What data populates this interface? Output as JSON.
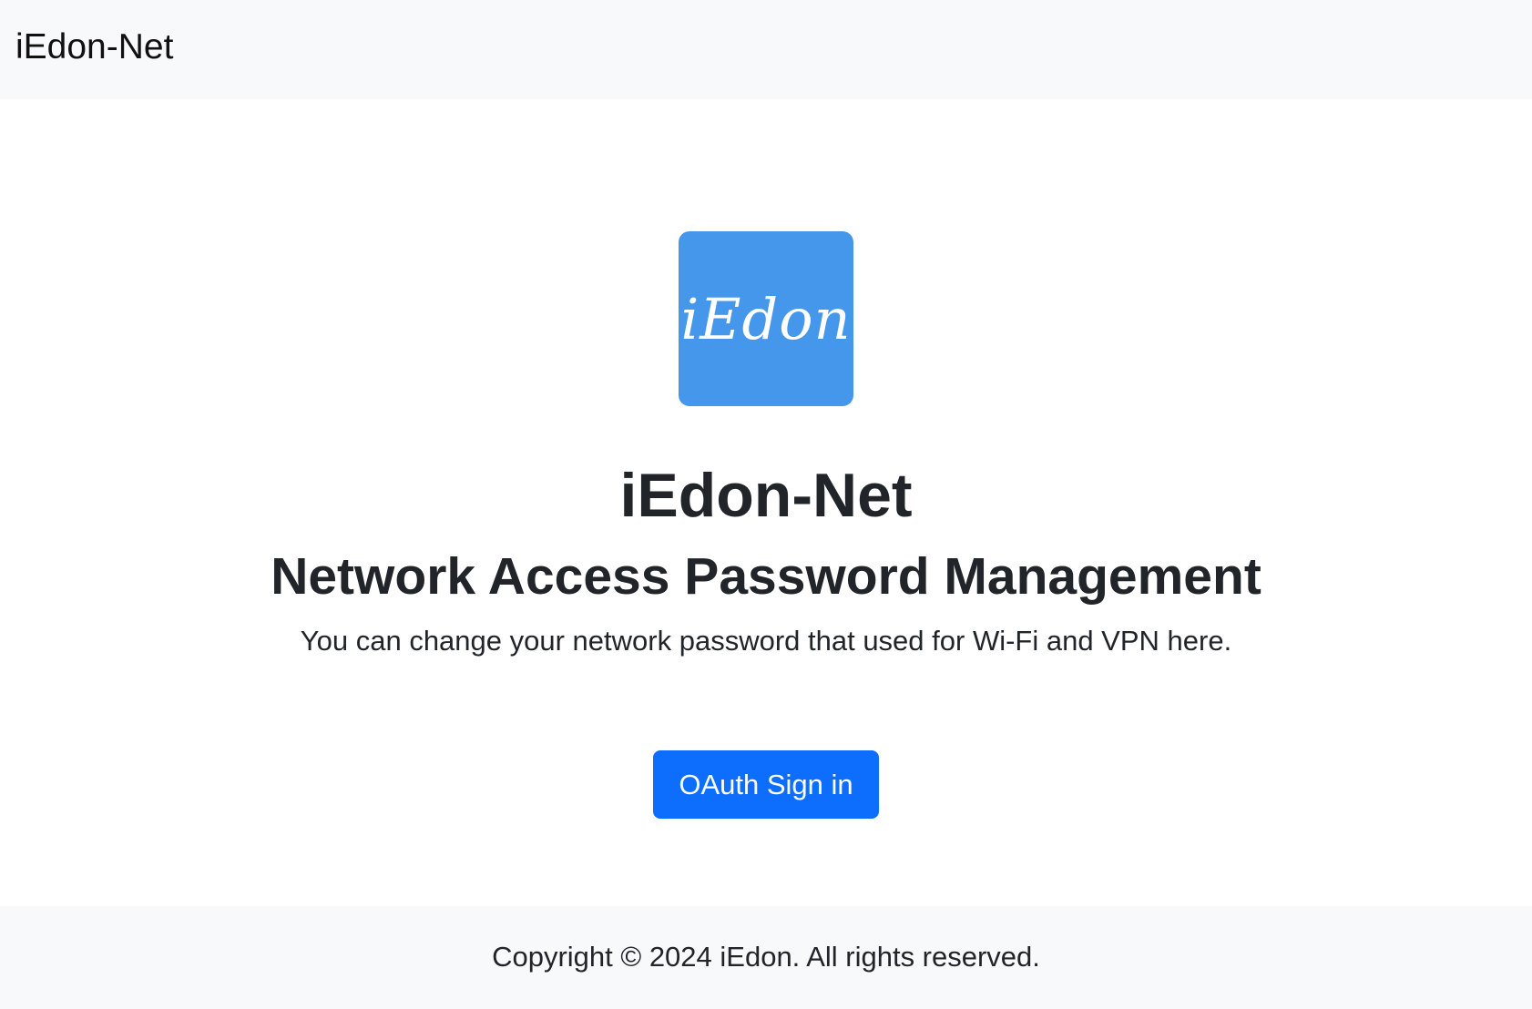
{
  "navbar": {
    "brand": "iEdon-Net"
  },
  "hero": {
    "logo_text": "iEdon",
    "logo_color": "#4497eb",
    "title": "iEdon-Net",
    "subtitle": "Network Access Password Management",
    "description": "You can change your network password that used for Wi-Fi and VPN here.",
    "signin_label": "OAuth Sign in"
  },
  "footer": {
    "copyright": "Copyright © 2024 iEdon. All rights reserved."
  }
}
